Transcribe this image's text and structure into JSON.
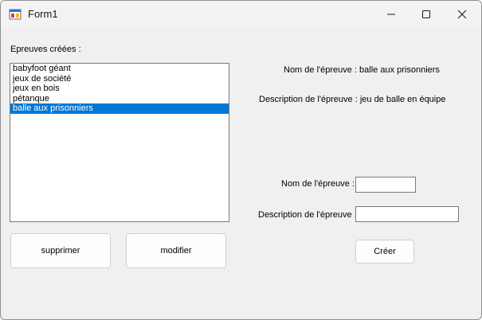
{
  "window": {
    "title": "Form1"
  },
  "list": {
    "label": "Epreuves créées :",
    "items": [
      "babyfoot géant",
      "jeux de société",
      "jeux en bois",
      "pétanque",
      "balle aux prisonniers"
    ],
    "selected_index": 4
  },
  "details": {
    "name_text": "Nom de l'épreuve : balle aux prisonniers",
    "desc_text": "Description de l'épreuve : jeu de balle en équipe"
  },
  "form": {
    "name_label": "Nom de l'épreuve :",
    "desc_label": "Description de l'épreuve :",
    "name_value": "",
    "desc_value": ""
  },
  "buttons": {
    "delete": "supprimer",
    "edit": "modifier",
    "create": "Créer"
  },
  "colors": {
    "selection": "#0078d7",
    "window_bg": "#f0f0f0"
  }
}
